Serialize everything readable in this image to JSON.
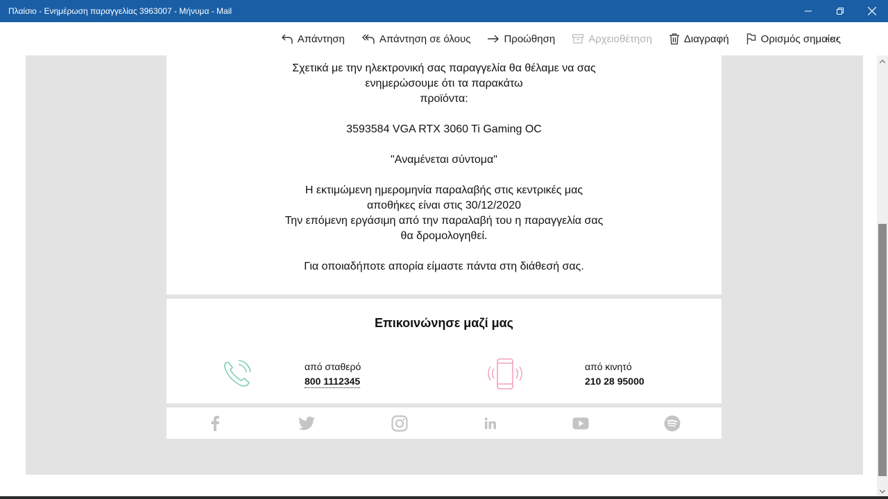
{
  "window": {
    "title": "Πλαίσιο - Ενημέρωση παραγγελίας 3963007 - Μήνυμα - Mail"
  },
  "toolbar": {
    "reply": "Απάντηση",
    "reply_all": "Απάντηση σε όλους",
    "forward": "Προώθηση",
    "archive": "Αρχειοθέτηση",
    "delete": "Διαγραφή",
    "flag": "Ορισμός σημαίας",
    "more": "···"
  },
  "message": {
    "lines": [
      "Σχετικά με την ηλεκτρονική σας παραγγελία θα θέλαμε να σας",
      "ενημερώσουμε ότι τα παρακάτω",
      "προϊόντα:",
      "",
      "3593584 VGA RTX 3060 Ti Gaming OC",
      "",
      "\"Αναμένεται σύντομα\"",
      "",
      "Η εκτιμώμενη ημερομηνία παραλαβής στις κεντρικές μας",
      "αποθήκες είναι στις 30/12/2020",
      "Την επόμενη εργάσιμη από την παραλαβή του η παραγγελία σας",
      "θα δρομολογηθεί.",
      "",
      "Για οποιαδήποτε απορία είμαστε πάντα στη διάθεσή σας."
    ]
  },
  "contact": {
    "title": "Επικοινώνησε μαζί μας",
    "landline_label": "από σταθερό",
    "landline_number": "800 1112345",
    "mobile_label": "από κινητό",
    "mobile_number": "210 28 95000",
    "phone_icon_color": "#7fcdbb",
    "mobile_icon_color": "#f3a1c0"
  },
  "social": {
    "icons": [
      "facebook-icon",
      "twitter-icon",
      "instagram-icon",
      "linkedin-icon",
      "youtube-icon",
      "spotify-icon"
    ],
    "icon_color": "#c4c4c4"
  },
  "colors": {
    "titlebar": "#1a5fa6",
    "reading_bg": "#e3e3e3"
  }
}
